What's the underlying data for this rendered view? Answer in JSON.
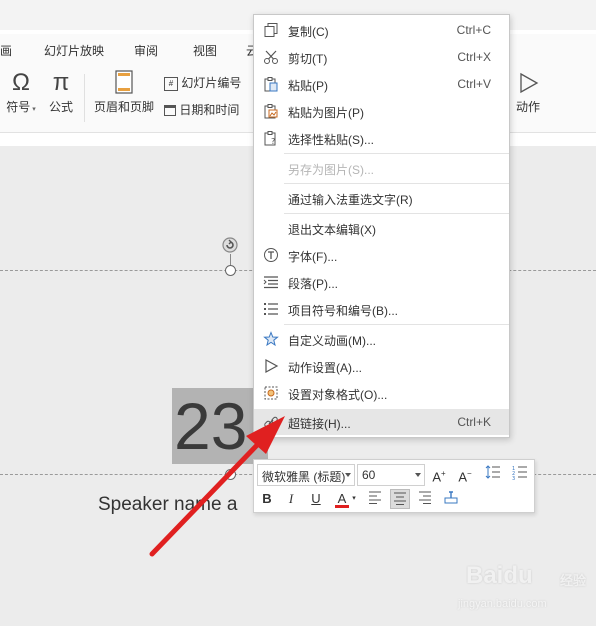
{
  "ribbon_tabs": [
    "画",
    "幻灯片放映",
    "审阅",
    "视图",
    "云"
  ],
  "ribbon_buttons": {
    "symbol": "符号",
    "formula": "公式",
    "header_footer": "页眉和页脚",
    "slide_number": "幻灯片编号",
    "date_time": "日期和时间",
    "action": "动作"
  },
  "slide": {
    "selected_text": "23",
    "speaker_text": "Speaker name a"
  },
  "context_menu": [
    {
      "label": "复制(C)",
      "shortcut": "Ctrl+C",
      "icon": "copy-icon"
    },
    {
      "label": "剪切(T)",
      "shortcut": "Ctrl+X",
      "icon": "scissors-icon"
    },
    {
      "label": "粘贴(P)",
      "shortcut": "Ctrl+V",
      "icon": "paste-icon"
    },
    {
      "label": "粘贴为图片(P)",
      "shortcut": "",
      "icon": "paste-as-picture-icon"
    },
    {
      "label": "选择性粘贴(S)...",
      "shortcut": "",
      "icon": "paste-special-icon"
    },
    {
      "label": "另存为图片(S)...",
      "shortcut": "",
      "icon": "",
      "disabled": true
    },
    {
      "label": "通过输入法重选文字(R)",
      "shortcut": "",
      "icon": ""
    },
    {
      "label": "退出文本编辑(X)",
      "shortcut": "",
      "icon": ""
    },
    {
      "label": "字体(F)...",
      "shortcut": "",
      "icon": "font-icon"
    },
    {
      "label": "段落(P)...",
      "shortcut": "",
      "icon": "paragraph-icon"
    },
    {
      "label": "项目符号和编号(B)...",
      "shortcut": "",
      "icon": "bullets-icon"
    },
    {
      "label": "自定义动画(M)...",
      "shortcut": "",
      "icon": "custom-animation-icon"
    },
    {
      "label": "动作设置(A)...",
      "shortcut": "",
      "icon": "action-play-icon"
    },
    {
      "label": "设置对象格式(O)...",
      "shortcut": "",
      "icon": "format-object-icon"
    },
    {
      "label": "超链接(H)...",
      "shortcut": "Ctrl+K",
      "icon": "hyperlink-icon",
      "highlighted": true
    }
  ],
  "mini_toolbar": {
    "font_name": "微软雅黑 (标题)",
    "font_size": "60"
  },
  "colors": {
    "arrow": "#e02020",
    "font_color_bar": "#e02020",
    "menu_highlight": "#e6e6e6",
    "canvas": "#ececec"
  },
  "watermark": {
    "logo": "Baidu",
    "cn": "经验",
    "url": "jingyan.baidu.com"
  }
}
